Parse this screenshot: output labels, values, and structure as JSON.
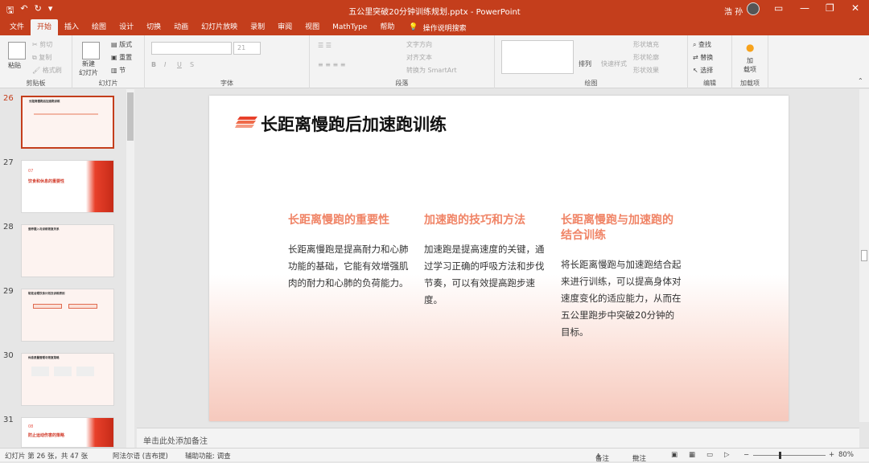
{
  "window": {
    "doc_title": "五公里突破20分钟训练规划.pptx  -  PowerPoint",
    "user_name": "浩 孙",
    "minimize": "—",
    "restore": "❐",
    "close": "✕"
  },
  "tabs": [
    "文件",
    "开始",
    "插入",
    "绘图",
    "设计",
    "切换",
    "动画",
    "幻灯片放映",
    "录制",
    "审阅",
    "视图",
    "MathType",
    "帮助"
  ],
  "search_label": "操作说明搜索",
  "ribbon": {
    "clipboard": {
      "paste": "粘贴",
      "cut": "剪切",
      "copy": "复制",
      "painter": "格式刷",
      "label": "剪贴板"
    },
    "slides": {
      "new_slide": "新建\n幻灯片",
      "layout": "版式",
      "reset": "重置",
      "section": "节",
      "label": "幻灯片"
    },
    "font": {
      "size": "21",
      "label": "字体"
    },
    "paragraph": {
      "text_dir": "文字方向",
      "align_text": "对齐文本",
      "smartart": "转换为 SmartArt",
      "label": "段落"
    },
    "drawing": {
      "arrange": "排列",
      "quick_styles": "快速样式",
      "fill": "形状填充",
      "outline": "形状轮廓",
      "effects": "形状效果",
      "label": "绘图"
    },
    "editing": {
      "find": "查找",
      "replace": "替换",
      "select": "选择",
      "label": "编辑"
    },
    "addins": {
      "button": "加\n载项",
      "label": "加载项"
    }
  },
  "thumbnails": [
    {
      "num": "26",
      "active": true,
      "title": "长距离慢跑后加速跑训练"
    },
    {
      "num": "27",
      "active": false,
      "section_num": "07",
      "title": "饮食和休息的重要性"
    },
    {
      "num": "28",
      "active": false,
      "title": "营养摄入与训练恢复关系"
    },
    {
      "num": "29",
      "active": false,
      "title": "制定合理饮食计划及训练原则"
    },
    {
      "num": "30",
      "active": false,
      "title": "休息质量管理与恢复策略"
    },
    {
      "num": "31",
      "active": false,
      "section_num": "08",
      "title": "防止运动伤害的策略"
    }
  ],
  "slide": {
    "title": "长距离慢跑后加速跑训练",
    "columns": [
      {
        "heading": "长距离慢跑的重要性",
        "body": "长距离慢跑是提高耐力和心肺功能的基础，它能有效增强肌肉的耐力和心肺的负荷能力。"
      },
      {
        "heading": "加速跑的技巧和方法",
        "body": "加速跑是提高速度的关键，通过学习正确的呼吸方法和步伐节奏，可以有效提高跑步速度。"
      },
      {
        "heading": "长距离慢跑与加速跑的结合训练",
        "body": "将长距离慢跑与加速跑结合起来进行训练，可以提高身体对速度变化的适应能力，从而在五公里跑步中突破20分钟的目标。"
      }
    ]
  },
  "notes_placeholder": "单击此处添加备注",
  "status": {
    "slide_info": "幻灯片 第 26 张，共 47 张",
    "language": "阿法尔语 (吉布提)",
    "accessibility": "辅助功能: 调查",
    "notes_btn": "备注",
    "comments_btn": "批注",
    "zoom": "80%",
    "zoom_level": 0.8
  },
  "colors": {
    "accent": "#c43e1c",
    "heading": "#f08466"
  }
}
